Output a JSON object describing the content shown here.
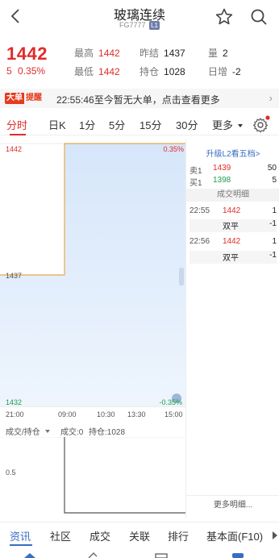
{
  "header": {
    "title": "玻璃连续",
    "code": "FG7777",
    "level_tag": "L1"
  },
  "quote": {
    "price": "1442",
    "change": "5",
    "change_pct": "0.35%",
    "high_label": "最高",
    "high": "1442",
    "low_label": "最低",
    "low": "1442",
    "prev_settle_label": "昨结",
    "prev_settle": "1437",
    "open_interest_label": "持仓",
    "open_interest": "1028",
    "volume_label": "量",
    "volume": "2",
    "daily_inc_label": "日增",
    "daily_inc": "-2"
  },
  "notice": {
    "badge_1": "大单",
    "badge_2": "提醒",
    "text": "22:55:46至今暂无大单，点击查看更多",
    "arrow": "›"
  },
  "tabs": [
    "分时",
    "日K",
    "1分",
    "5分",
    "15分",
    "30分",
    "更多"
  ],
  "chart": {
    "y_top": "1442",
    "y_mid": "1437",
    "y_bot": "1432",
    "pct_top": "0.35%",
    "pct_bot": "-0.35%",
    "x_labels": [
      "21:00",
      "09:00",
      "10:30",
      "13:30",
      "15:00"
    ],
    "vol_tick": "0.5"
  },
  "chart_data": {
    "type": "line",
    "ylim": [
      1432,
      1442
    ],
    "series": [
      {
        "values": [
          1437,
          1437,
          1442,
          1442,
          1442
        ]
      }
    ],
    "note_y_pct": [
      "0.35%",
      "-0.35%"
    ]
  },
  "volume_bar": {
    "selector": "成交/持仓",
    "volume_label": "成交:0",
    "oi_label": "持仓:1028"
  },
  "panel": {
    "upgrade": "升级L2看五档>",
    "book": [
      {
        "label": "卖1",
        "price": "1439",
        "qty": "50"
      },
      {
        "label": "买1",
        "price": "1398",
        "qty": "5"
      }
    ],
    "detail_head": "成交明细",
    "trades": [
      {
        "time": "22:55",
        "price": "1442",
        "qty": "1",
        "type": "双平",
        "delta": "-1"
      },
      {
        "time": "22:56",
        "price": "1442",
        "qty": "1",
        "type": "双平",
        "delta": "-1"
      }
    ],
    "more": "更多明细..."
  },
  "bottom_tabs": [
    "资讯",
    "社区",
    "成交",
    "关联",
    "排行",
    "基本面(F10)"
  ],
  "colors": {
    "up": "#e12b2b",
    "down": "#1f9b4c",
    "accent": "#3a6cc4"
  }
}
